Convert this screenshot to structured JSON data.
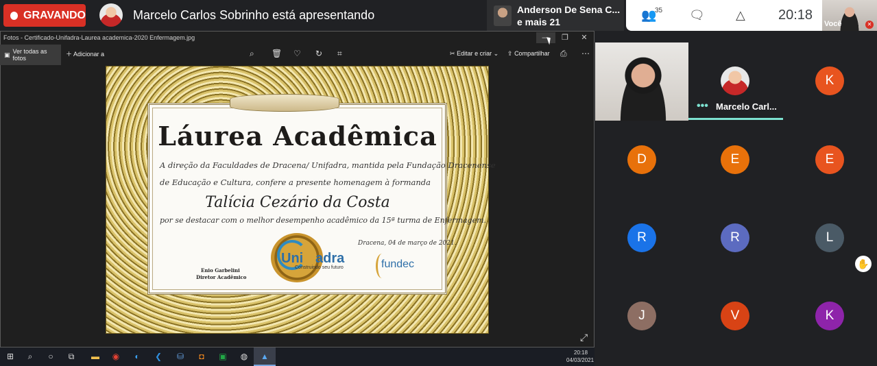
{
  "meet": {
    "recording_label": "GRAVANDO",
    "presenting_text": "Marcelo Carlos Sobrinho está apresentando",
    "speaker_name": "Anderson De Sena C...",
    "speaker_more": "e mais 21",
    "people_count": "35",
    "clock": "20:18",
    "self_label": "Você",
    "colors": {
      "record": "#d93025",
      "background": "#202124",
      "active_speaker": "#7de2d1"
    }
  },
  "photos": {
    "title": "Fotos - Certificado-Unifadra-Laurea academica-2020 Enfermagem.jpg",
    "view_all": "Ver todas as fotos",
    "add_to": "Adicionar a",
    "edit_create": "Editar e criar",
    "share": "Compartilhar"
  },
  "certificate": {
    "title": "Láurea Acadêmica",
    "line1": "A direção da Faculdades de Dracena/ Unifadra, mantida pela Fundação Dracenense",
    "line2": "de Educação e Cultura, confere a presente homenagem à formanda",
    "name": "Talícia Cezário da Costa",
    "line3": "por se destacar com o melhor desempenho acadêmico da 15ª turma de Enfermagem.",
    "date": "Dracena, 04 de março de 2021.",
    "signer_name": "Enio Garbelini",
    "signer_role": "Diretor Acadêmico",
    "logo_a": "Uni",
    "logo_b": "adra",
    "logo_tagline": "Construindo seu futuro",
    "logo_fundec": "fundec"
  },
  "taskbar": {
    "time": "20:18",
    "date": "04/03/2021"
  },
  "participants": {
    "marcelo_name": "Marcelo Carl...",
    "tiles": [
      {
        "letter": "K",
        "color": "#e8541f"
      },
      {
        "letter": "D",
        "color": "#e8710a"
      },
      {
        "letter": "E",
        "color": "#e8710a"
      },
      {
        "letter": "E",
        "color": "#e8541f"
      },
      {
        "letter": "R",
        "color": "#1a73e8"
      },
      {
        "letter": "R",
        "color": "#5c6bc0"
      },
      {
        "letter": "L",
        "color": "#4a5a66"
      },
      {
        "letter": "J",
        "color": "#8d6e63"
      },
      {
        "letter": "V",
        "color": "#d84315"
      },
      {
        "letter": "K",
        "color": "#8e24aa"
      }
    ]
  }
}
